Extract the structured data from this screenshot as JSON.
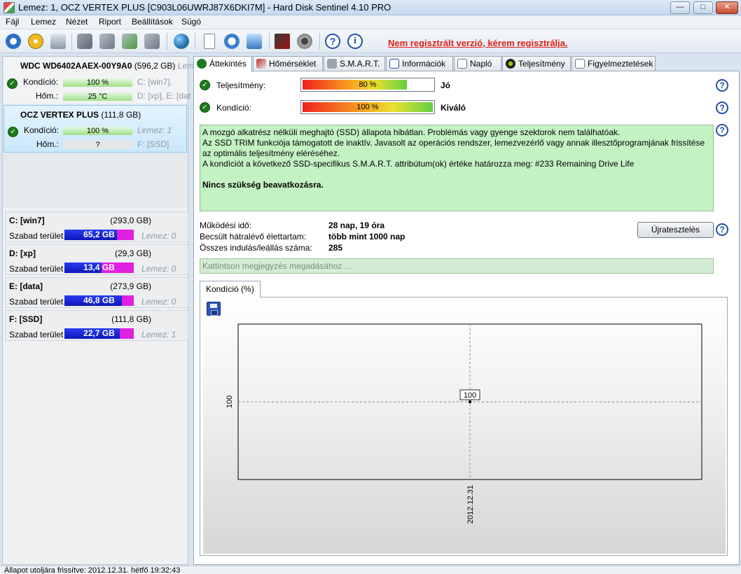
{
  "window": {
    "title": "Lemez: 1, OCZ VERTEX PLUS [C903L06UWRJ87X6DKI7M]  -  Hard Disk Sentinel 4.10 PRO",
    "controls": {
      "minimize": "—",
      "maximize": "□",
      "close": "✕"
    }
  },
  "menu": [
    {
      "label": "Fájl"
    },
    {
      "label": "Lemez"
    },
    {
      "label": "Nézet"
    },
    {
      "label": "Riport"
    },
    {
      "label": "Beállítások"
    },
    {
      "label": "Súgó"
    }
  ],
  "toolbar": {
    "registration_notice": "Nem regisztrált verzió, kérem regisztrálja.",
    "icons": [
      "refresh-icon",
      "alert-icon",
      "disk-icon",
      "usb-icon",
      "usb-info-icon",
      "usb-check-icon",
      "usb-remove-icon",
      "globe-icon",
      "report-icon",
      "sync-icon",
      "network-icon",
      "settings-icon",
      "speaker-icon",
      "help-icon",
      "info-icon"
    ]
  },
  "disks": [
    {
      "name": "WDC WD6402AAEX-00Y9A0",
      "size": "(596,2 GB)",
      "extra": "Lem",
      "condition_label": "Kondíció:",
      "condition_value": "100 %",
      "condition_fraction": 1.0,
      "condition_volumes": "C: [win7],",
      "temp_label": "Hőm.:",
      "temp_value": "25 °C",
      "temp_volumes": "D: [xp], E: [dat"
    },
    {
      "name": "OCZ VERTEX PLUS",
      "size": "(111,8 GB)",
      "condition_label": "Kondíció:",
      "condition_value": "100 %",
      "condition_fraction": 1.0,
      "condition_volumes": "Lemez: 1",
      "temp_label": "Hőm.:",
      "temp_value": "?",
      "temp_volumes": "F: [SSD]"
    }
  ],
  "volumes": [
    {
      "name": "C: [win7]",
      "size": "(293,0 GB)",
      "free_label": "Szabad terület",
      "free": "65,2 GB",
      "free_fraction": 0.76,
      "disk": "Lemez: 0"
    },
    {
      "name": "D: [xp]",
      "size": "(29,3 GB)",
      "free_label": "Szabad terület",
      "free": "13,4 GB",
      "free_fraction": 0.54,
      "disk": "Lemez: 0"
    },
    {
      "name": "E: [data]",
      "size": "(273,9 GB)",
      "free_label": "Szabad terület",
      "free": "46,8 GB",
      "free_fraction": 0.83,
      "disk": "Lemez: 0"
    },
    {
      "name": "F: [SSD]",
      "size": "(111,8 GB)",
      "free_label": "Szabad terület",
      "free": "22,7 GB",
      "free_fraction": 0.8,
      "disk": "Lemez: 1"
    }
  ],
  "tabs": [
    {
      "label": "Áttekintés",
      "active": true
    },
    {
      "label": "Hőmérséklet"
    },
    {
      "label": "S.M.A.R.T."
    },
    {
      "label": "Információk"
    },
    {
      "label": "Napló"
    },
    {
      "label": "Teljesítmény"
    },
    {
      "label": "Figyelmeztetések"
    }
  ],
  "overview": {
    "performance_label": "Teljesítmény:",
    "performance_value": "80 %",
    "performance_fraction": 0.8,
    "performance_text": "Jó",
    "condition_label": "Kondíció:",
    "condition_value": "100 %",
    "condition_fraction": 1.0,
    "condition_text": "Kiváló",
    "description": [
      "A mozgó alkatrész nélküli meghajtó (SSD) állapota hibátlan. Problémás vagy gyenge szektorok nem találhatóak.",
      "Az SSD TRIM funkciója támogatott de inaktív. Javasolt az operációs rendszer, lemezvezérlő vagy annak illesztőprogramjának frissítése az optimális teljesítmény eléréséhez.",
      "A kondíciót a következő SSD-specifikus S.M.A.R.T. attribútum(ok) értéke határozza meg:  #233 Remaining Drive Life"
    ],
    "recommendation": "Nincs szükség beavatkozásra.",
    "uptime_label": "Működési idő:",
    "uptime_value": "28 nap, 19 óra",
    "lifetime_label": "Becsült hátralévő élettartam:",
    "lifetime_value": "több mint 1000 nap",
    "startstop_label": "Összes indulás/leállás száma:",
    "startstop_value": "285",
    "retest_button": "Újratesztelés",
    "note_placeholder": "Kattintson megjegyzés megadásához ..."
  },
  "chart_tab": "Kondíció  (%)",
  "chart_data": {
    "type": "line",
    "x": [
      "2012.12.31"
    ],
    "series": [
      {
        "values": [
          100
        ]
      }
    ],
    "data_labels": [
      "100"
    ],
    "ytick_labels": [
      "100"
    ],
    "xtick_labels": [
      "2012.12.31"
    ],
    "grid": false
  },
  "statusbar": {
    "text": "Állapot utoljára frissítve: 2012.12.31. hétfő 19:32:43"
  }
}
